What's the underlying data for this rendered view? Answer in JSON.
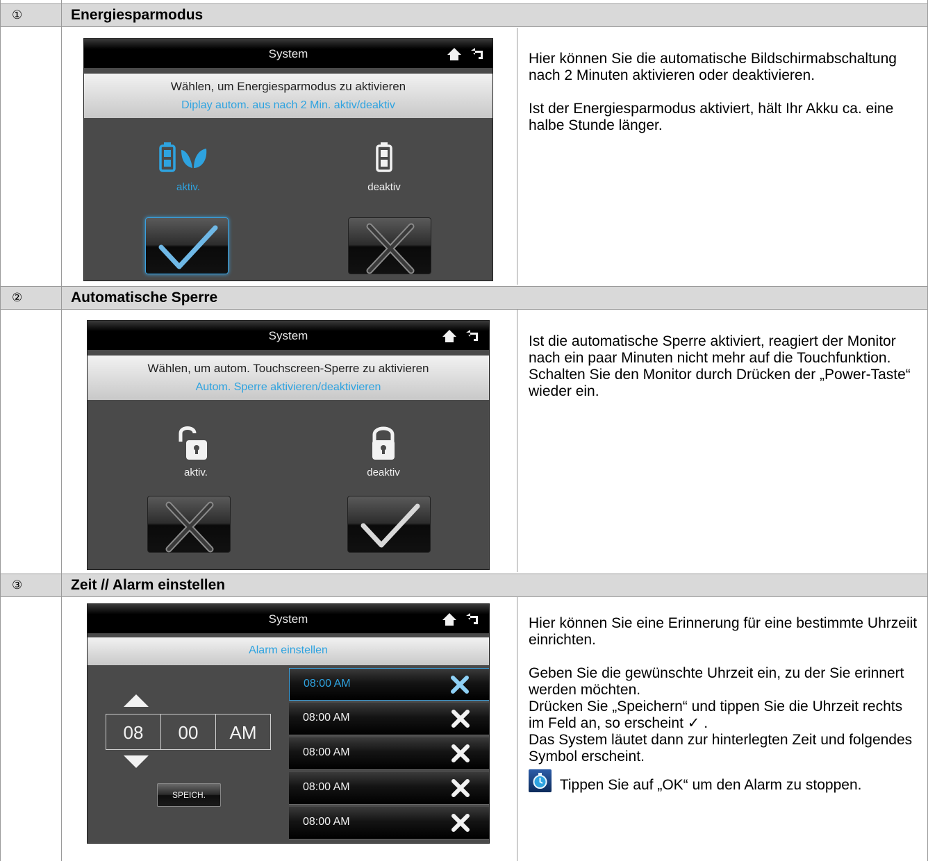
{
  "rows": [
    {
      "number": "①",
      "title": "Energiesparmodus",
      "screen": {
        "title": "System",
        "line1": "Wählen, um Energiesparmodus zu aktivieren",
        "line2": "Diplay autom. aus nach 2 Min. aktiv/deaktiv",
        "option_left": "aktiv.",
        "option_right": "deaktiv",
        "selected": "left"
      },
      "description": [
        "Hier können Sie die automatische Bildschirmabschaltung nach 2 Minuten aktivieren oder deaktivieren.",
        "Ist der Energiesparmodus aktiviert, hält Ihr Akku ca. eine halbe Stunde länger."
      ]
    },
    {
      "number": "②",
      "title": "Automatische Sperre",
      "screen": {
        "title": "System",
        "line1": "Wählen, um autom. Touchscreen-Sperre zu aktivieren",
        "line2": "Autom. Sperre aktivieren/deaktivieren",
        "option_left": "aktiv.",
        "option_right": "deaktiv",
        "selected": "right"
      },
      "description": [
        "Ist die automatische Sperre aktiviert, reagiert der Monitor nach ein paar Minuten nicht mehr auf die Touchfunktion. Schalten Sie den Monitor durch Drücken der „Power-Taste“ wieder ein."
      ]
    },
    {
      "number": "③",
      "title": "Zeit // Alarm einstellen",
      "screen": {
        "title": "System",
        "bar": "Alarm einstellen",
        "hour": "08",
        "minute": "00",
        "ampm": "AM",
        "save_label": "SPEICH.",
        "alarms": [
          "08:00 AM",
          "08:00 AM",
          "08:00 AM",
          "08:00 AM",
          "08:00 AM"
        ]
      },
      "description": [
        "Hier können Sie eine Erinnerung für eine bestimmte Uhrzeiit einrichten.",
        "Geben Sie die gewünschte Uhrzeit ein, zu der Sie erinnert werden möchten.",
        "Drücken Sie „Speichern“ und tippen Sie die Uhrzeit rechts im Feld an, so erscheint ✓ .",
        "Das System läutet dann zur hinterlegten Zeit und folgendes Symbol erscheint.",
        "Tippen Sie auf „OK“ um den Alarm zu stoppen."
      ]
    }
  ],
  "colors": {
    "accent": "#2ea3e0",
    "header_bg": "#d9d9d9",
    "screen_bg": "#4a4a4a"
  }
}
